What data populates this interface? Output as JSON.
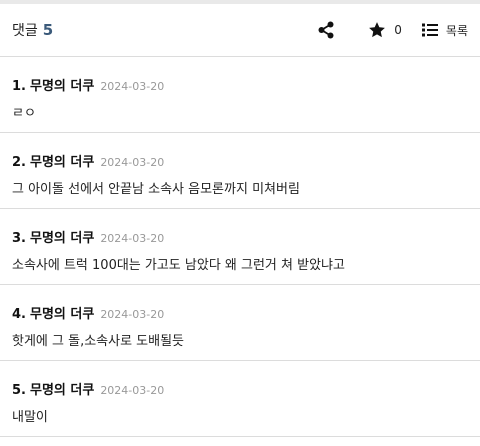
{
  "header": {
    "title": "댓글",
    "count": "5",
    "star_count": "0",
    "list_label": "목록",
    "icons": {
      "share": "share-icon",
      "star": "star-icon",
      "list": "list-icon"
    }
  },
  "comments": [
    {
      "num": "1.",
      "author": "무명의 더쿠",
      "date": "2024-03-20",
      "text": "ㄹㅇ"
    },
    {
      "num": "2.",
      "author": "무명의 더쿠",
      "date": "2024-03-20",
      "text": "그 아이돌 선에서 안끝남 소속사 음모론까지 미쳐버림"
    },
    {
      "num": "3.",
      "author": "무명의 더쿠",
      "date": "2024-03-20",
      "text": "소속사에 트럭 100대는 가고도 남았다 왜 그런거 쳐 받았냐고"
    },
    {
      "num": "4.",
      "author": "무명의 더쿠",
      "date": "2024-03-20",
      "text": "핫게에 그 돌,소속사로 도배될듯"
    },
    {
      "num": "5.",
      "author": "무명의 더쿠",
      "date": "2024-03-20",
      "text": "내말이"
    }
  ],
  "colors": {
    "count_accent": "#3b5a7a",
    "date_gray": "#999999",
    "divider": "#dcdcdc"
  }
}
